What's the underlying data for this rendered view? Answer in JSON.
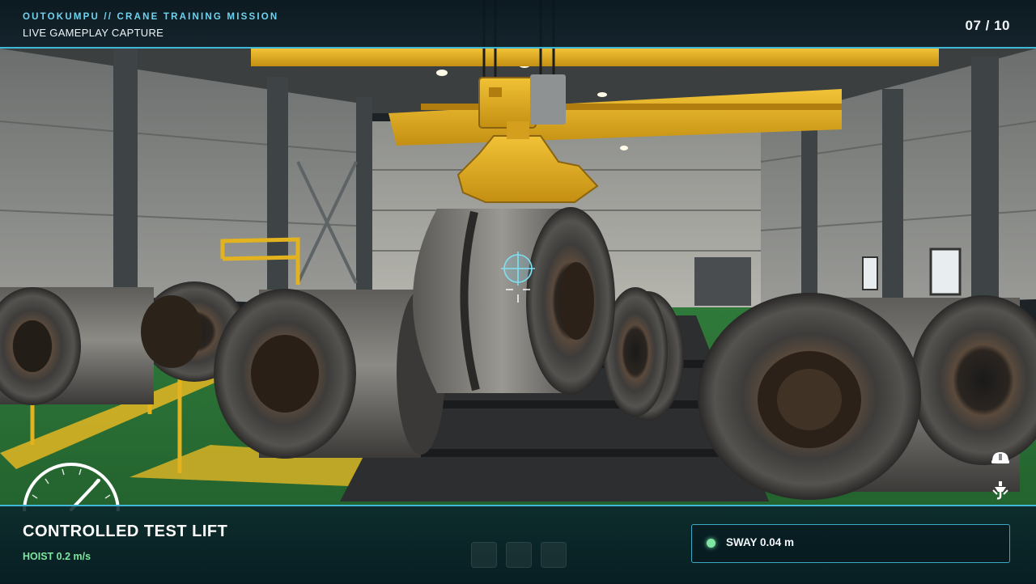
{
  "header": {
    "mission_label": "OUTOKUMPU // CRANE TRAINING MISSION",
    "capture_label": "LIVE GAMEPLAY CAPTURE",
    "counter": "07 / 10"
  },
  "footer": {
    "phase_title": "CONTROLLED TEST LIFT",
    "hoist_readout": "HOIST 0.2 m/s",
    "sway_readout": "SWAY 0.04 m"
  },
  "icons": {
    "helmet": "helmet-icon",
    "hook": "crane-hook-icon",
    "gauge": "speed-gauge-icon",
    "crosshair": "crosshair-icon"
  },
  "colors": {
    "accent": "#3fb8d8",
    "status_ok": "#7ee6a0",
    "crane_yellow": "#e7b020",
    "floor_green": "#2f7a3a"
  }
}
